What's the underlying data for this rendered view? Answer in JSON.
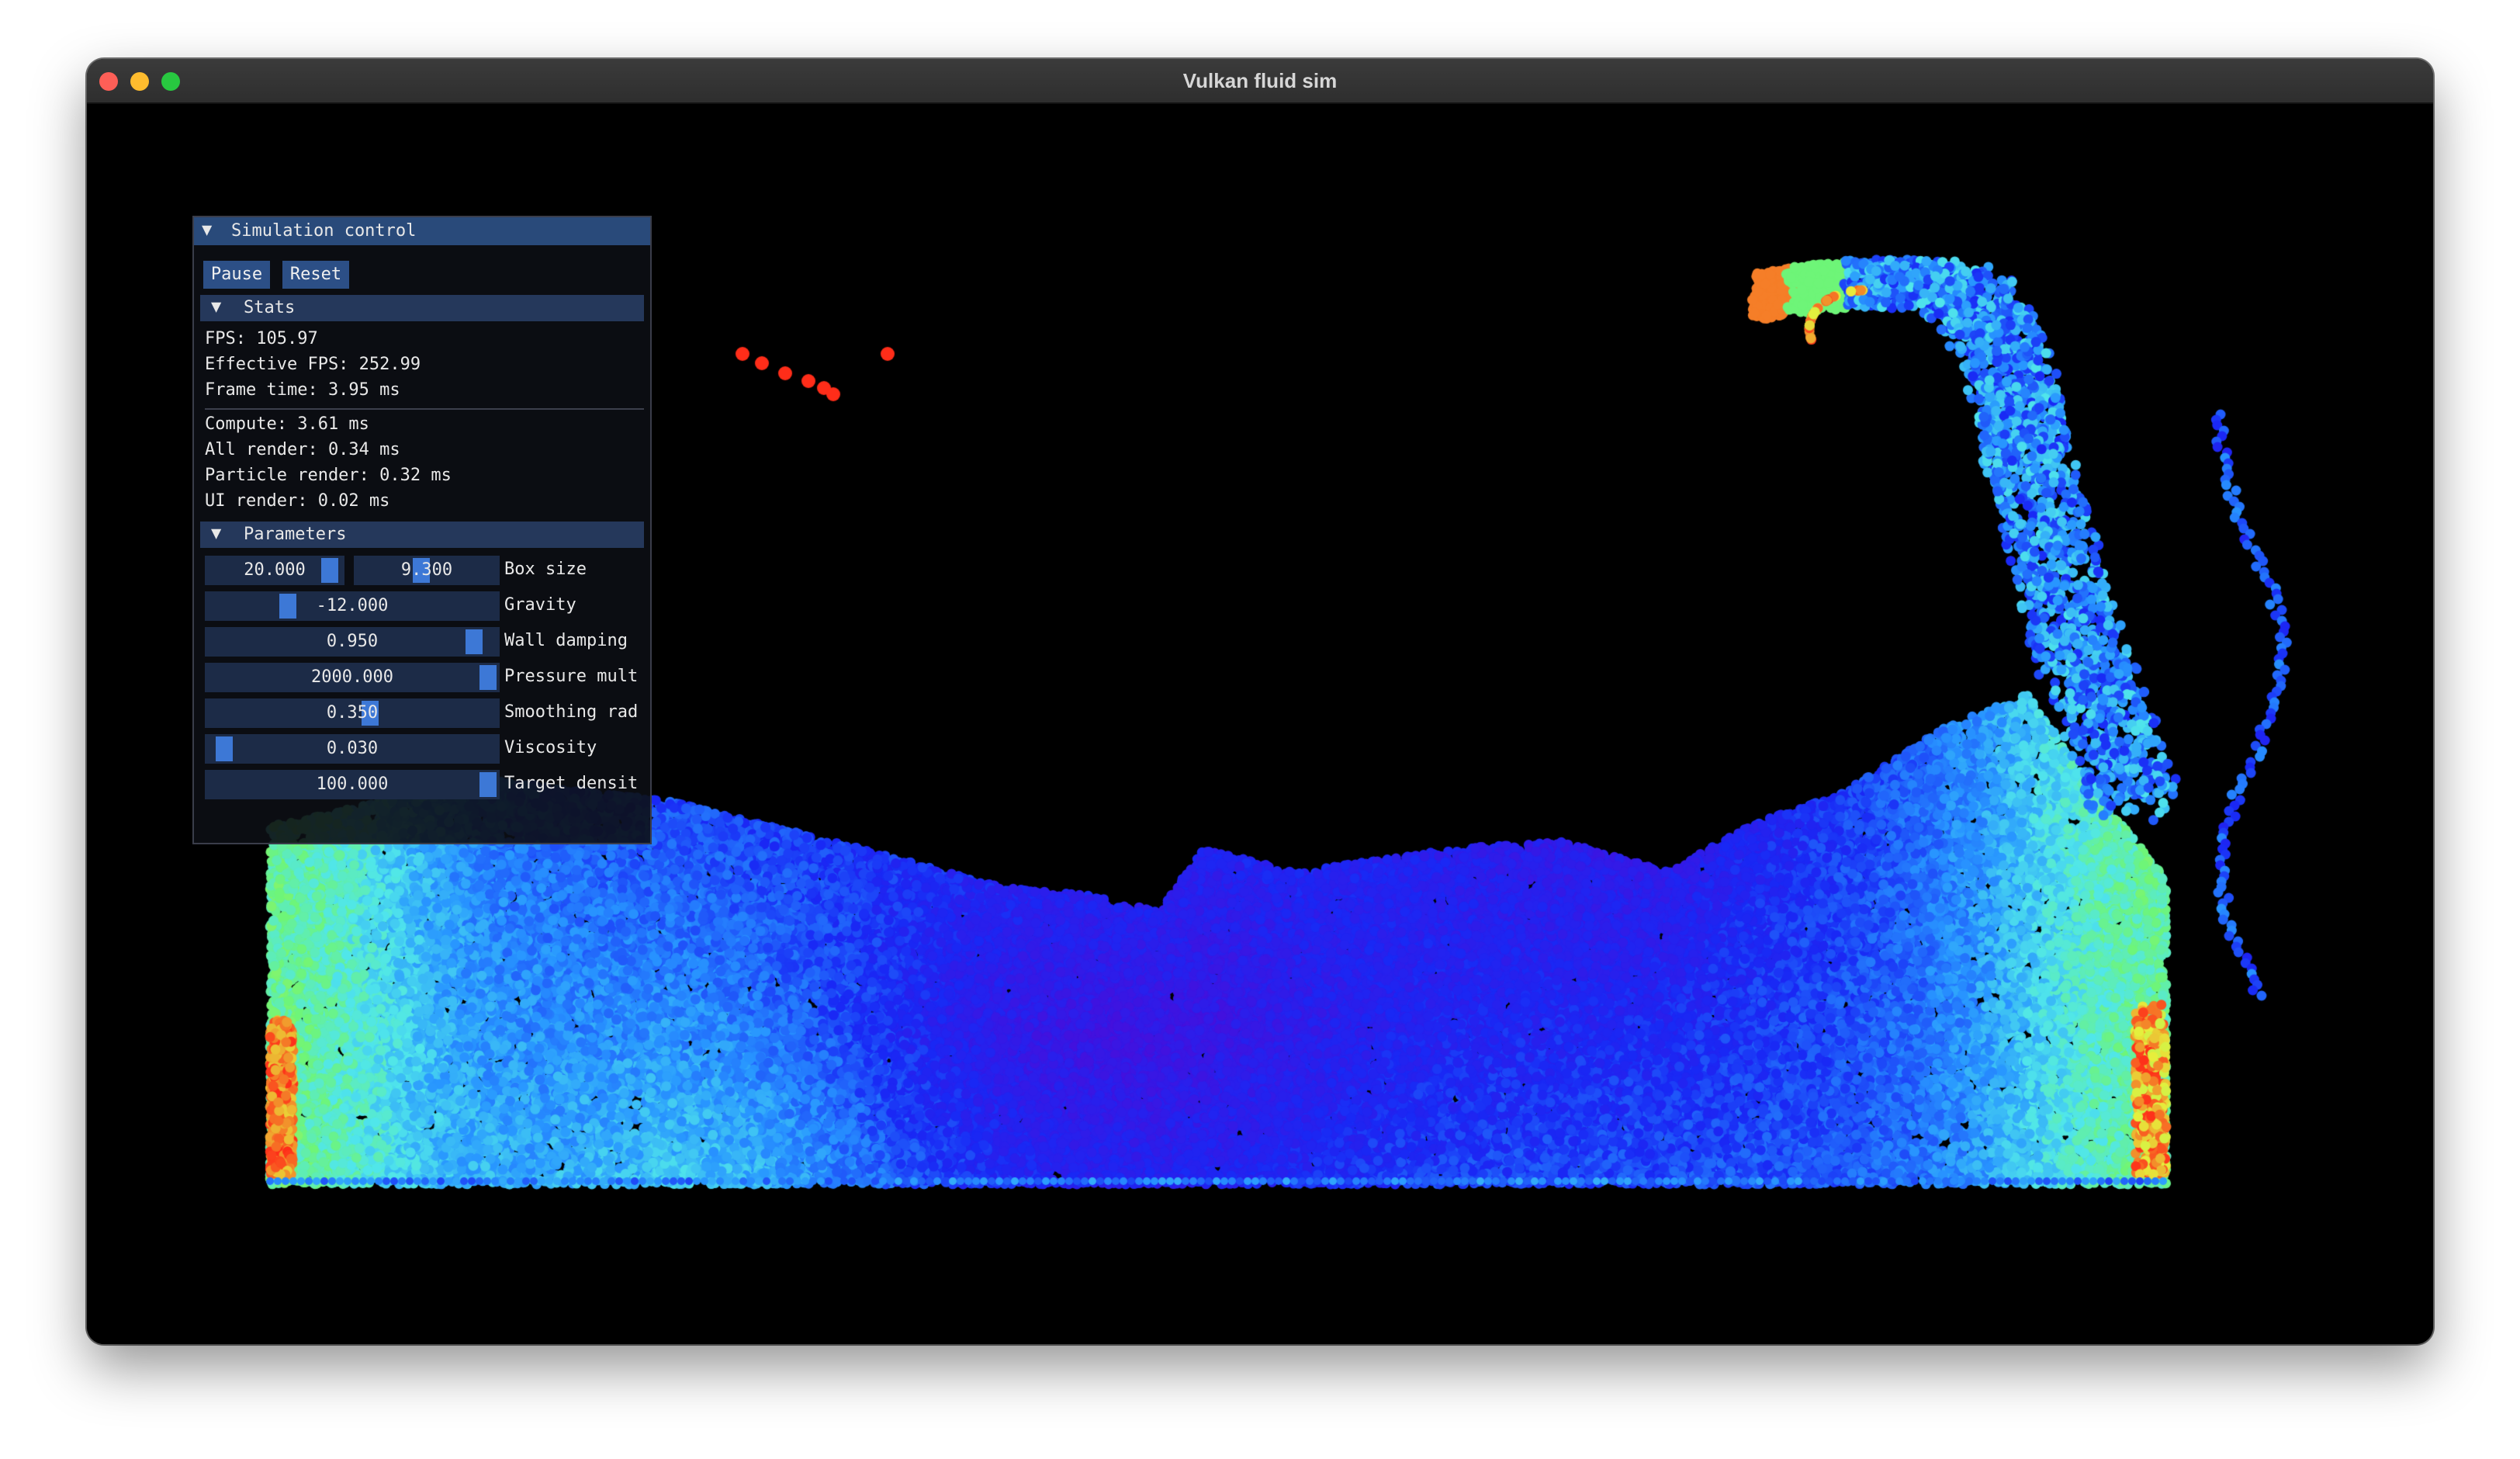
{
  "window": {
    "title": "Vulkan fluid sim"
  },
  "panel": {
    "title": "Simulation control",
    "buttons": {
      "pause": "Pause",
      "reset": "Reset"
    },
    "stats": {
      "header": "Stats",
      "fps": "FPS: 105.97",
      "effective_fps": "Effective FPS: 252.99",
      "frame_time": "Frame time: 3.95 ms",
      "compute": "Compute: 3.61 ms",
      "all_render": "All render: 0.34 ms",
      "particle_render": "Particle render: 0.32 ms",
      "ui_render": "UI render: 0.02 ms"
    },
    "parameters": {
      "header": "Parameters",
      "box_size": {
        "label": "Box size",
        "x": "20.000",
        "y": "9.300"
      },
      "gravity": {
        "label": "Gravity",
        "value": "-12.000"
      },
      "wall_damping": {
        "label": "Wall damping",
        "value": "0.950"
      },
      "pressure_mult": {
        "label": "Pressure mult",
        "value": "2000.000"
      },
      "smoothing_rad": {
        "label": "Smoothing rad",
        "value": "0.350"
      },
      "viscosity": {
        "label": "Viscosity",
        "value": "0.030"
      },
      "target_density": {
        "label": "Target densit",
        "value": "100.000"
      }
    }
  },
  "colors": {
    "title_bar_bg": "#2e2e2e",
    "panel_title_bg": "#294a7a",
    "button_bg": "#2c4f86",
    "slider_bg": "#1c2b47",
    "slider_grab": "#3d78d6",
    "fast_particle": "#ff2a1a",
    "slow_particle": "#3a10d8"
  }
}
